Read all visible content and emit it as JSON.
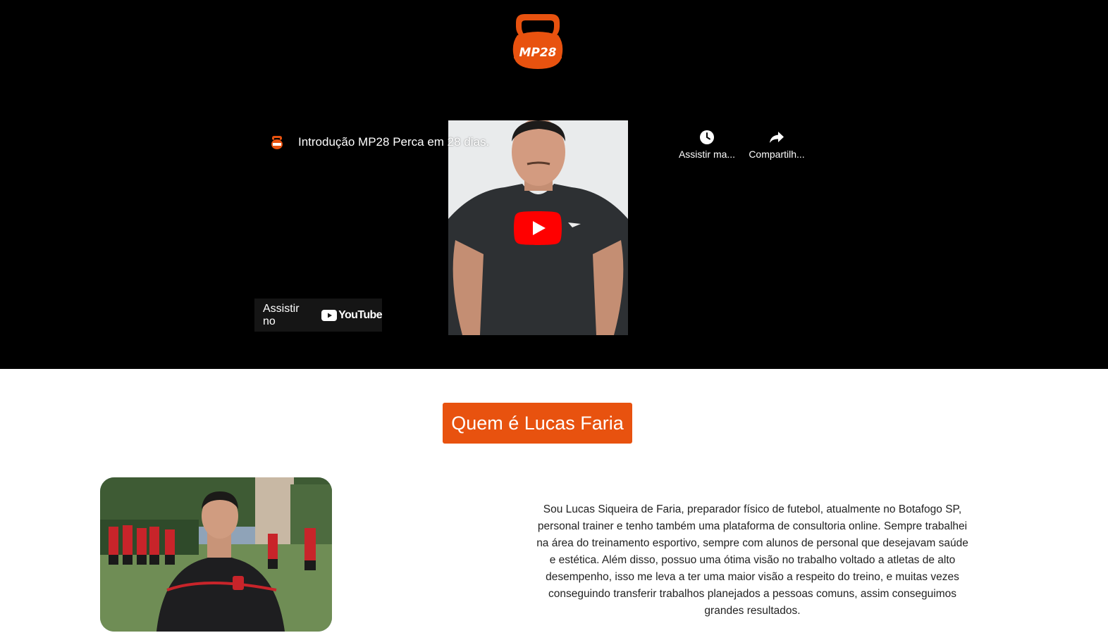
{
  "brand": {
    "logo_text": "MP28",
    "accent_color": "#e8520f"
  },
  "video": {
    "title": "Introdução MP28 Perca em 28 dias.",
    "channel_icon": "mp28-kettlebell-icon",
    "actions": [
      {
        "label": "Assistir ma...",
        "icon": "clock-icon"
      },
      {
        "label": "Compartilh...",
        "icon": "share-icon"
      }
    ],
    "play_icon": "youtube-play-icon",
    "watch_on_label": "Assistir no",
    "platform_name": "YouTube"
  },
  "about": {
    "heading": "Quem é Lucas Faria",
    "bio": "Sou Lucas Siqueira de Faria, preparador físico de futebol, atualmente no Botafogo SP, personal trainer e tenho também uma plataforma de consultoria online. Sempre trabalhei na área do treinamento esportivo, sempre com alunos de personal que desejavam saúde e estética. Além disso, possuo uma ótima visão no trabalho voltado a atletas de alto desempenho, isso me leva a ter uma maior visão a respeito do treino, e muitas vezes conseguindo transferir trabalhos planejados a pessoas comuns, assim conseguimos grandes resultados."
  }
}
